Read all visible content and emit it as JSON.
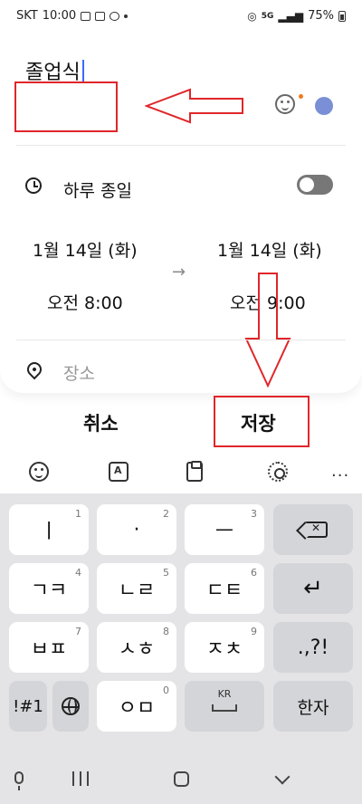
{
  "status_bar": {
    "carrier": "SKT",
    "time": "10:00",
    "signal": "5G",
    "battery": "75%"
  },
  "event": {
    "title": "졸업식",
    "all_day_label": "하루 종일",
    "all_day_on": false,
    "start_date": "1월 14일 (화)",
    "start_time": "오전 8:00",
    "end_date": "1월 14일 (화)",
    "end_time": "오전 9:00",
    "arrow": "→",
    "location_placeholder": "장소"
  },
  "actions": {
    "cancel": "취소",
    "save": "저장"
  },
  "keyboard": {
    "more": "...",
    "row1": [
      {
        "label": "ㅣ",
        "num": "1"
      },
      {
        "label": "·",
        "num": "2"
      },
      {
        "label": "ㅡ",
        "num": "3"
      }
    ],
    "row2": [
      {
        "label": "ㄱㅋ",
        "num": "4"
      },
      {
        "label": "ㄴㄹ",
        "num": "5"
      },
      {
        "label": "ㄷㅌ",
        "num": "6"
      }
    ],
    "row3": [
      {
        "label": "ㅂㅍ",
        "num": "7"
      },
      {
        "label": "ㅅㅎ",
        "num": "8"
      },
      {
        "label": "ㅈㅊ",
        "num": "9"
      }
    ],
    "row4": [
      {
        "label": "ㅇㅁ",
        "num": "0"
      }
    ],
    "symbols_label": "!#1",
    "punct_label": ".,?!",
    "space_lang": "KR",
    "hanja_label": "한자"
  },
  "colors": {
    "event_color": "#7b8fd6",
    "annotation_red": "#e0262a",
    "caret": "#3b6cff"
  }
}
